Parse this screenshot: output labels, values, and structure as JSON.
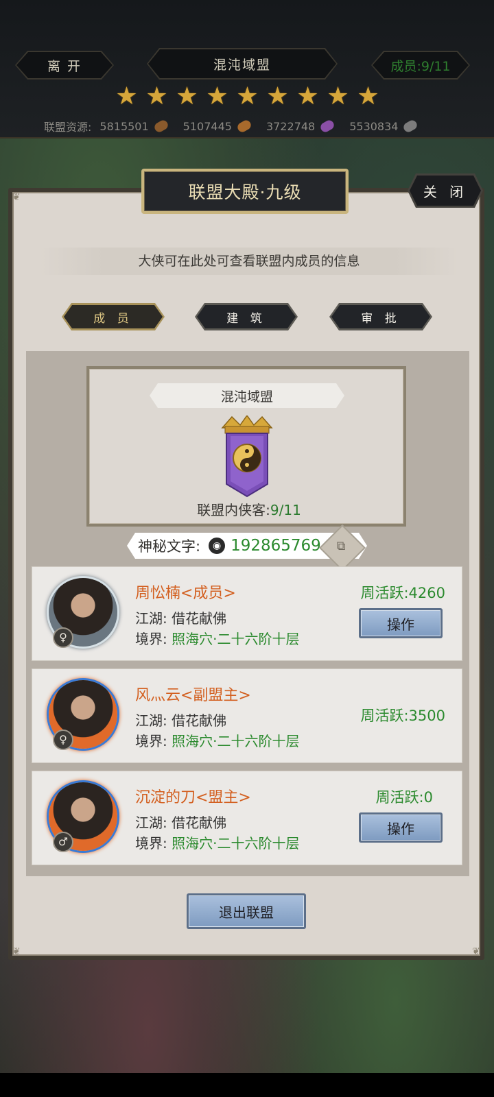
{
  "header": {
    "leave_label": "离 开",
    "alliance_name": "混沌域盟",
    "members_label": "成员:9/11",
    "stars_count": 9,
    "resources_label": "联盟资源:",
    "resources": [
      {
        "value": "5815501",
        "icon": "wood-log-icon",
        "color": "#8a5a2c"
      },
      {
        "value": "5107445",
        "icon": "leaf-scroll-icon",
        "color": "#a86a2c"
      },
      {
        "value": "3722748",
        "icon": "purple-crystal-icon",
        "color": "#8b4fa6"
      },
      {
        "value": "5530834",
        "icon": "iron-ingot-icon",
        "color": "#7c7c7c"
      }
    ]
  },
  "dialog": {
    "title": "联盟大殿·九级",
    "close_label": "关 闭",
    "description": "大侠可在此处可查看联盟内成员的信息",
    "tabs": [
      {
        "label": "成 员",
        "active": true
      },
      {
        "label": "建 筑",
        "active": false
      },
      {
        "label": "审 批",
        "active": false
      }
    ]
  },
  "emblem": {
    "name": "混沌域盟",
    "members_prefix": "联盟内侠客:",
    "members_value": "9/11",
    "icon": "yin-yang-banner-icon"
  },
  "secret": {
    "label": "神秘文字:",
    "icon": "qq-penguin-icon",
    "number": "192865769",
    "copy_icon": "copy-icon"
  },
  "members": [
    {
      "name": "周忪楠<成员>",
      "jianghu_label": "江湖:",
      "jianghu_value": "借花献佛",
      "realm_label": "境界:",
      "realm_value": "照海穴·二十六阶十层",
      "activity": "周活跃:4260",
      "gender": "♀",
      "has_action": true,
      "action_label": "操作",
      "avatar_colors": [
        "#6a7680",
        "#d7e1e6"
      ]
    },
    {
      "name": "风灬云<副盟主>",
      "jianghu_label": "江湖:",
      "jianghu_value": "借花献佛",
      "realm_label": "境界:",
      "realm_value": "照海穴·二十六阶十层",
      "activity": "周活跃:3500",
      "gender": "♀",
      "has_action": false,
      "action_label": "",
      "avatar_colors": [
        "#e06a2a",
        "#3a7bd6"
      ]
    },
    {
      "name": "沉淀的刀<盟主>",
      "jianghu_label": "江湖:",
      "jianghu_value": "借花献佛",
      "realm_label": "境界:",
      "realm_value": "照海穴·二十六阶十层",
      "activity": "周活跃:0",
      "gender": "♂",
      "has_action": true,
      "action_label": "操作",
      "avatar_colors": [
        "#e06a2a",
        "#3a7bd6"
      ]
    }
  ],
  "quit_label": "退出联盟"
}
